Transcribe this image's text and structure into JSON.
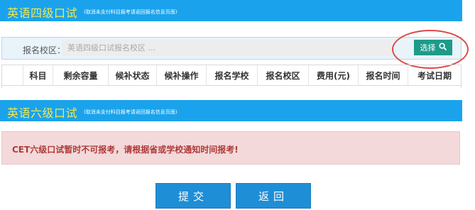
{
  "cet4": {
    "title": "英语四级口试",
    "note": "(取消未支付科目报考请返回报名信息页面)",
    "search": {
      "label": "报名校区：",
      "placeholder": "英语四级口试报名校区 ...",
      "select_label": "选择",
      "icon": "search-icon"
    },
    "table": {
      "columns": [
        "",
        "科目",
        "剩余容量",
        "候补状态",
        "候补操作",
        "报名学校",
        "报名校区",
        "费用(元)",
        "报名时间",
        "考试日期"
      ]
    }
  },
  "cet6": {
    "title": "英语六级口试",
    "note": "(取消未支付科目报考请返回报名信息页面)",
    "alert": "CET六级口试暂时不可报考，请根据省或学校通知时间报考!"
  },
  "actions": {
    "submit_label": "提交",
    "back_label": "返回"
  },
  "colors": {
    "banner": "#1aa3ec",
    "banner_title": "#f5e84a",
    "select_button": "#1e9a8a",
    "alert_bg": "#f3d9da",
    "alert_text": "#b03a3a",
    "action_button": "#1e8fd6",
    "highlight_oval": "#e04848"
  }
}
